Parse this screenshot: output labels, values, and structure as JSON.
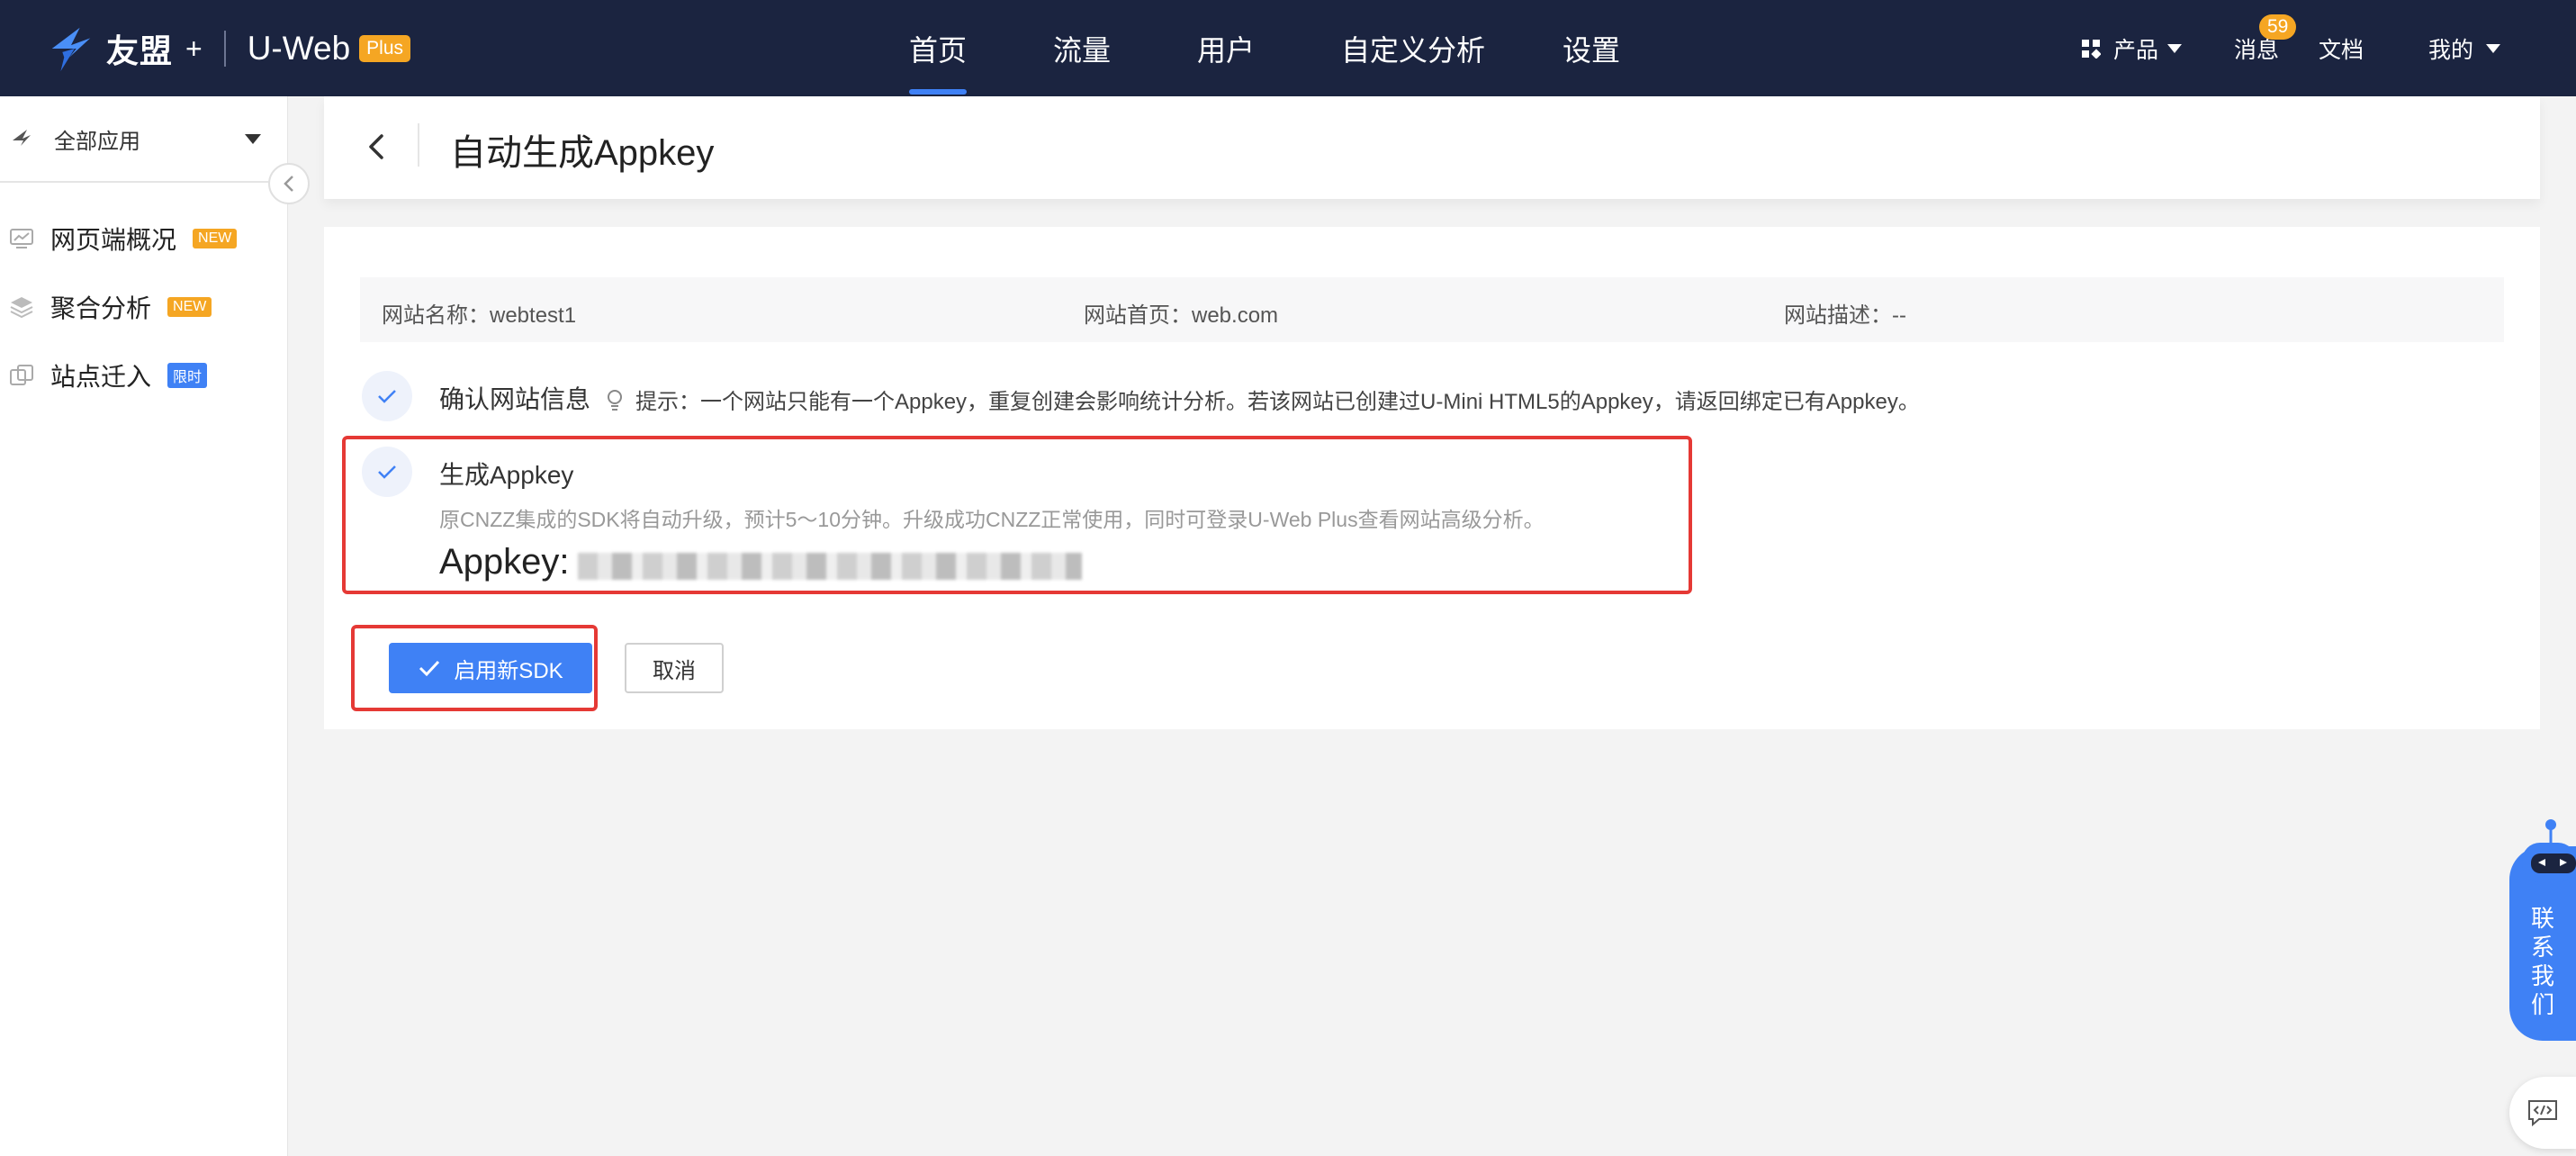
{
  "brand": {
    "name": "友盟",
    "plus_sign": "+",
    "product": "U-Web",
    "badge": "Plus"
  },
  "nav": [
    "首页",
    "流量",
    "用户",
    "自定义分析",
    "设置"
  ],
  "nav_active": "首页",
  "tools": {
    "products": "产品",
    "messages": "消息",
    "messages_badge": "59",
    "docs": "文档",
    "mine": "我的"
  },
  "sidebar": {
    "app_select": "全部应用",
    "items": [
      {
        "label": "网页端概况",
        "tag": "NEW",
        "icon": "monitor-chart-icon"
      },
      {
        "label": "聚合分析",
        "tag": "NEW",
        "icon": "layers-icon"
      },
      {
        "label": "站点迁入",
        "tag": "限时",
        "icon": "migrate-icon"
      }
    ]
  },
  "header": {
    "title": "自动生成Appkey"
  },
  "site_info": {
    "name_label": "网站名称：",
    "name_value": "webtest1",
    "home_label": "网站首页：",
    "home_value": "web.com",
    "desc_label": "网站描述：",
    "desc_value": "--"
  },
  "steps": {
    "confirm": {
      "title": "确认网站信息",
      "hint": "提示：一个网站只能有一个Appkey，重复创建会影响统计分析。若该网站已创建过U-Mini HTML5的Appkey，请返回绑定已有Appkey。"
    },
    "generate": {
      "title": "生成Appkey",
      "desc": "原CNZZ集成的SDK将自动升级，预计5～10分钟。升级成功CNZZ正常使用，同时可登录U-Web Plus查看网站高级分析。",
      "appkey_label": "Appkey:"
    }
  },
  "actions": {
    "enable": "启用新SDK",
    "cancel": "取消"
  },
  "contact": {
    "label": "联系我们"
  },
  "colors": {
    "topbar": "#1b2440",
    "accent": "#3f81f5",
    "badge": "#f5a623",
    "highlight": "#e53935"
  }
}
